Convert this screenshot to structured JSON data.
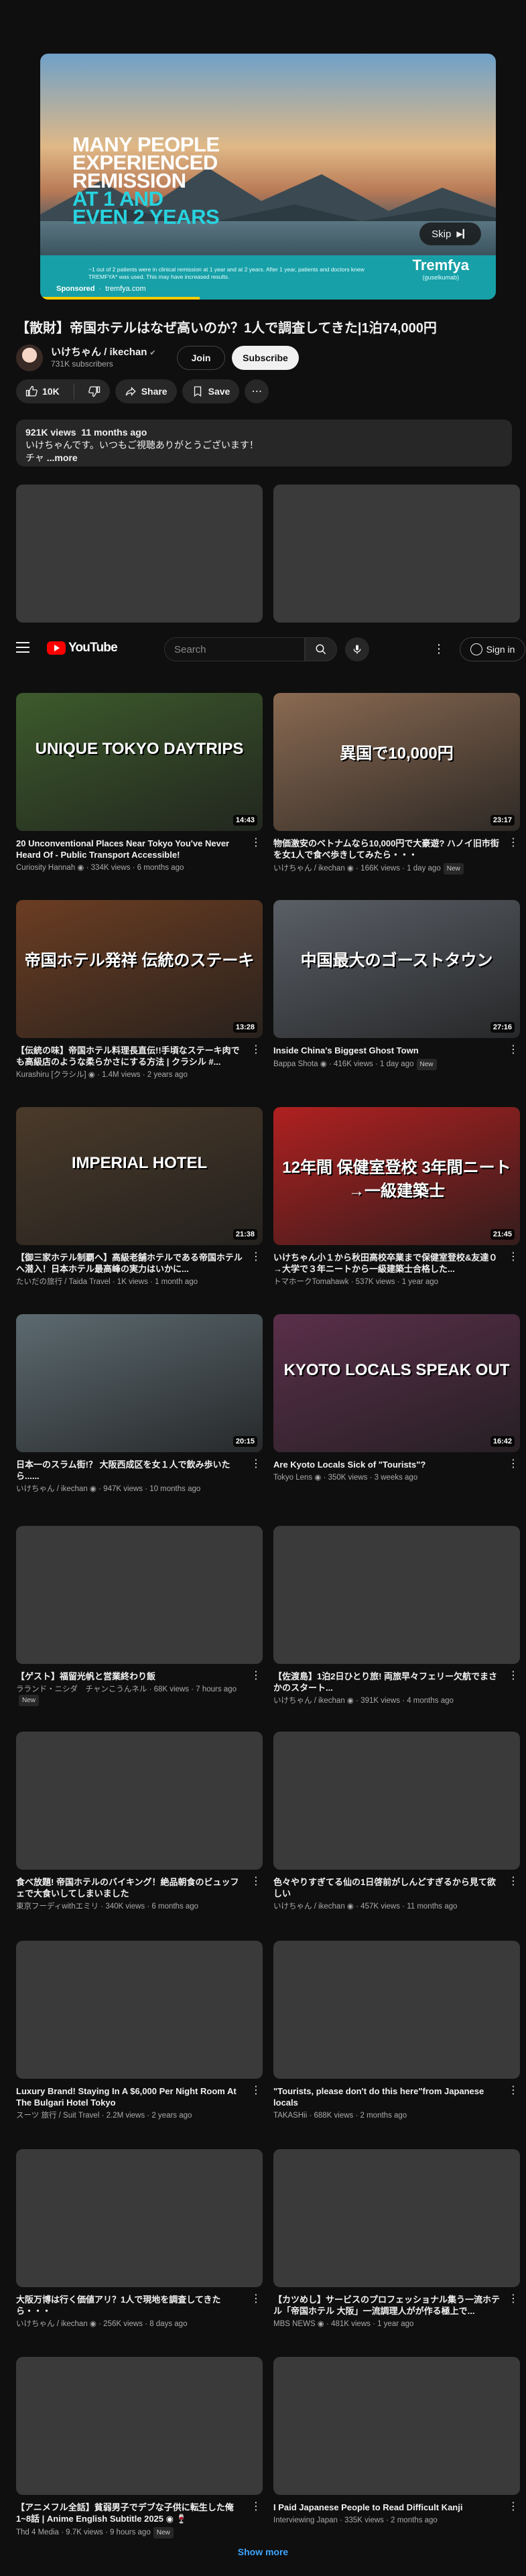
{
  "ad": {
    "headline_lines": [
      {
        "text": "MANY PEOPLE",
        "accent": false
      },
      {
        "text": "EXPERIENCED",
        "accent": false
      },
      {
        "text": "REMISSION",
        "accent": false
      },
      {
        "text": "at 1 and",
        "accent": true
      },
      {
        "text": "even 2 years",
        "accent": true
      }
    ],
    "skip_label": "Skip",
    "disclaimer": "~1 out of 2 patients were in clinical remission at 1 year and at 2 years. After 1 year, patients and doctors knew TREMFYA* was used. This may have increased results.",
    "brand_name": "Tremfya",
    "brand_generic": "(guselkumab)",
    "sponsored_label": "Sponsored",
    "domain": "tremfya.com",
    "progress": 0.35,
    "accent_color": "#27d3df"
  },
  "video": {
    "title": "【散財】帝国ホテルはなぜ高いのか？1人で調査してきた|1泊74,000円",
    "channel_name": "いけちゃん / ikechan",
    "subscribers": "731K subscribers",
    "join_label": "Join",
    "subscribe_label": "Subscribe",
    "likes": "10K",
    "share_label": "Share",
    "save_label": "Save",
    "views": "921K views",
    "age": "11 months ago",
    "description_line1": "いけちゃんです。いつもご視聴ありがとうございます！",
    "description_line2": "チャ",
    "more_label": "...more"
  },
  "header": {
    "logo_text": "YouTube",
    "search_placeholder": "Search",
    "signin_label": "Sign in"
  },
  "cards": [
    {
      "title": "",
      "sub": "",
      "new": "",
      "duration": "",
      "overlay": "",
      "placeholder": true
    },
    {
      "title": "",
      "sub": "",
      "new": "",
      "duration": "",
      "overlay": "",
      "placeholder": true
    },
    {
      "title": "20 Unconventional Places Near Tokyo You've Never Heard Of - Public Transport Accessible!",
      "sub": "Curiosity Hannah ◉ · 334K views · 6 months ago",
      "new": "",
      "duration": "14:43",
      "overlay": "UNIQUE TOKYO DAYTRIPS",
      "bg": "#3d5a2c",
      "placeholder": false
    },
    {
      "title": "物価激安のベトナムなら10,000円で大豪遊? ハノイ旧市街を女1人で食べ歩きしてみたら・・・",
      "sub": "いけちゃん / ikechan ◉ · 166K views · 1 day ago",
      "new": "New",
      "duration": "23:17",
      "overlay": "異国で10,000円",
      "bg": "#8a6a52",
      "placeholder": false
    },
    {
      "title": "【伝統の味】帝国ホテル料理長直伝!!手頃なステーキ肉でも高級店のような柔らかさにする方法 | クラシル #...",
      "sub": "Kurashiru [クラシル] ◉ · 1.4M views · 2 years ago",
      "new": "",
      "duration": "13:28",
      "overlay": "帝国ホテル発祥 伝統のステーキ",
      "bg": "#6b3d22",
      "placeholder": false
    },
    {
      "title": "Inside China's Biggest Ghost Town",
      "sub": "Bappa Shota ◉ · 416K views · 1 day ago",
      "new": "New",
      "duration": "27:16",
      "overlay": "中国最大のゴーストタウン",
      "bg": "#5a5f66",
      "placeholder": false
    },
    {
      "title": "【御三家ホテル制覇へ】高級老舗ホテルである帝国ホテルへ潜入！日本ホテル最高峰の実力はいかに...",
      "sub": "たいだの旅行 / Taida Travel · 1K views · 1 month ago",
      "new": "",
      "duration": "21:38",
      "overlay": "IMPERIAL HOTEL",
      "bg": "#4a3a2a",
      "placeholder": false
    },
    {
      "title": "いけちゃん小１から秋田高校卒業まで保健室登校&友達０→大学で３年ニートから一級建築士合格した...",
      "sub": "トマホークTomahawk · 537K views · 1 year ago",
      "new": "",
      "duration": "21:45",
      "overlay": "12年間 保健室登校 3年間ニート→一級建築士",
      "bg": "#b02020",
      "placeholder": false
    },
    {
      "title": "日本一のスラム街!？ 大阪西成区を女１人で飲み歩いた ら......",
      "sub": "いけちゃん / ikechan ◉ · 947K views · 10 months ago",
      "new": "",
      "duration": "20:15",
      "overlay": "",
      "bg": "#5c6a70",
      "placeholder": false
    },
    {
      "title": "Are Kyoto Locals Sick of \"Tourists\"?",
      "sub": "Tokyo Lens ◉ · 350K views · 3 weeks ago",
      "new": "",
      "duration": "16:42",
      "overlay": "KYOTO LOCALS SPEAK OUT",
      "bg": "#5a2f4a",
      "placeholder": false
    },
    {
      "title": "【ゲスト】福留光帆と営業終わり飯",
      "sub": "ラランド・ニシダ　チャンこうんネル · 68K views · 7 hours ago",
      "new": "New",
      "duration": "",
      "overlay": "",
      "placeholder": true
    },
    {
      "title": "【佐渡島】1泊2日ひとり旅! 両旅早々フェリー欠航でまさかのスタート...",
      "sub": "いけちゃん / ikechan ◉ · 391K views · 4 months ago",
      "new": "",
      "duration": "",
      "overlay": "",
      "placeholder": true
    },
    {
      "title": "食べ放題! 帝国ホテルのバイキング！絶品朝食のビュッフェで大食いしてしまいました",
      "sub": "東京フーディwithエミリ · 340K views · 6 months ago",
      "new": "",
      "duration": "",
      "overlay": "",
      "placeholder": true
    },
    {
      "title": "色々やりすぎてる仙の1日啓前がしんどすぎるから見て欲しい",
      "sub": "いけちゃん / ikechan ◉ · 457K views · 11 months ago",
      "new": "",
      "duration": "",
      "overlay": "",
      "placeholder": true
    },
    {
      "title": "Luxury Brand! Staying In A $6,000 Per Night Room At The Bulgari Hotel Tokyo",
      "sub": "スーツ 旅行 / Suit Travel · 2.2M views · 2 years ago",
      "new": "",
      "duration": "",
      "overlay": "",
      "placeholder": true
    },
    {
      "title": "\"Tourists, please don't do this here\"from Japanese locals",
      "sub": "TAKASHii · 688K views · 2 months ago",
      "new": "",
      "duration": "",
      "overlay": "",
      "placeholder": true
    },
    {
      "title": "大阪万博は行く価値アリ？1人で現地を調査してきた ら・・・",
      "sub": "いけちゃん / ikechan ◉ · 256K views · 8 days ago",
      "new": "",
      "duration": "",
      "overlay": "",
      "placeholder": true
    },
    {
      "title": "【カツめし】サービスのプロフェッショナル集う一流ホテル「帝国ホテル 大阪」一流調理人がが作る極上で...",
      "sub": "MBS NEWS ◉ · 481K views · 1 year ago",
      "new": "",
      "duration": "",
      "overlay": "",
      "placeholder": true
    },
    {
      "title": "【アニメフル全話】貧弱男子でデブな子供に転生した俺 1~8話 | Anime English Subtitle 2025 ◉ 🍷",
      "sub": "Thd 4 Media · 9.7K views · 9 hours ago",
      "new": "New",
      "duration": "",
      "overlay": "",
      "placeholder": true
    },
    {
      "title": "I Paid Japanese People to Read Difficult Kanji",
      "sub": "Interviewing Japan · 335K views · 2 months ago",
      "new": "",
      "duration": "",
      "overlay": "",
      "placeholder": true
    }
  ],
  "show_more_label": "Show more"
}
